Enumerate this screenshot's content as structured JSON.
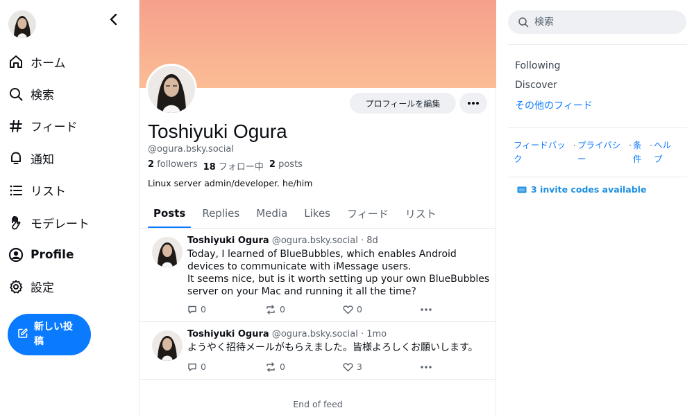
{
  "colors": {
    "accent": "#0a7aff",
    "banner_top": "#f5a08c",
    "banner_bottom": "#fbbd94",
    "muted": "#59616b"
  },
  "sidebar": {
    "items": [
      {
        "icon": "home-icon",
        "label": "ホーム"
      },
      {
        "icon": "search-icon",
        "label": "検索"
      },
      {
        "icon": "hash-icon",
        "label": "フィード"
      },
      {
        "icon": "bell-icon",
        "label": "通知"
      },
      {
        "icon": "list-icon",
        "label": "リスト"
      },
      {
        "icon": "hand-icon",
        "label": "モデレート"
      },
      {
        "icon": "user-icon",
        "label": "Profile",
        "active": true
      },
      {
        "icon": "gear-icon",
        "label": "設定"
      }
    ],
    "compose_label": "新しい投稿"
  },
  "profile": {
    "edit_label": "プロフィールを編集",
    "display_name": "Toshiyuki Ogura",
    "handle": "@ogura.bsky.social",
    "followers_count": "2",
    "followers_label": "followers",
    "following_count": "18",
    "following_label": "フォロー中",
    "posts_count": "2",
    "posts_label": "posts",
    "bio": "Linux server admin/developer. he/him"
  },
  "tabs": [
    "Posts",
    "Replies",
    "Media",
    "Likes",
    "フィード",
    "リスト"
  ],
  "posts": [
    {
      "name": "Toshiyuki Ogura",
      "handle": "@ogura.bsky.social",
      "time": "· 8d",
      "line1": "Today, I learned of BlueBubbles, which enables Android devices to communicate with iMessage users.",
      "line2": "It seems nice, but is it worth setting up your own BlueBubbles server on your Mac and running it all the time?",
      "replies": "0",
      "reposts": "0",
      "likes": "0"
    },
    {
      "name": "Toshiyuki Ogura",
      "handle": "@ogura.bsky.social",
      "time": "· 1mo",
      "line1": "ようやく招待メールがもらえました。皆様よろしくお願いします。",
      "replies": "0",
      "reposts": "0",
      "likes": "3"
    }
  ],
  "end_of_feed": "End of feed",
  "right": {
    "search_placeholder": "検索",
    "feeds": [
      "Following",
      "Discover"
    ],
    "more_feeds": "その他のフィード",
    "footer": [
      "フィードバック",
      "プライバシー",
      "条件",
      "ヘルプ"
    ],
    "invite": "3 invite codes available"
  }
}
